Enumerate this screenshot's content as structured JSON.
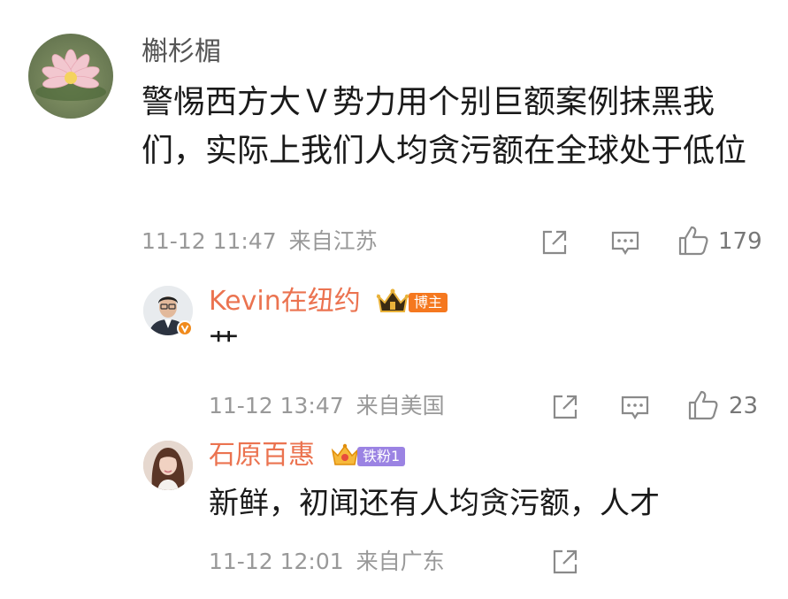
{
  "main_comment": {
    "username": "槲杉楣",
    "text": "警惕西方大Ｖ势力用个别巨额案例抹黑我们，实际上我们人均贪污额在全球处于低位",
    "time": "11-12 11:47",
    "location": "来自江苏",
    "like_count": "179",
    "icons": [
      "share-icon",
      "comment-icon",
      "like-icon"
    ]
  },
  "replies": [
    {
      "username": "Kevin在纽约",
      "badge_text": "博主",
      "text": "艹",
      "time": "11-12 13:47",
      "location": "来自美国",
      "like_count": "23",
      "icons": [
        "crown-icon",
        "verified-v-icon",
        "share-icon",
        "comment-icon",
        "like-icon"
      ]
    },
    {
      "username": "石原百惠",
      "badge_text": "铁粉1",
      "text": "新鲜，初闻还有人均贪污额，人才",
      "time": "11-12 12:01",
      "location": "来自广东",
      "icons": [
        "crown-icon",
        "share-icon"
      ]
    }
  ],
  "colors": {
    "reply_name": "#eb7350",
    "meta_text": "#999999",
    "boss_badge": "#f5781f",
    "fan_badge": "#9b83e3"
  }
}
